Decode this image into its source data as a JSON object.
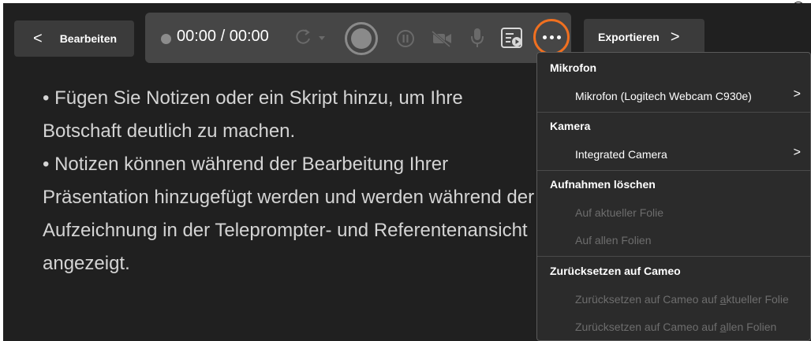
{
  "help_icon_glyph": "?",
  "back_button": {
    "icon": "chevron-left-icon",
    "chevron": "<",
    "label": "Bearbeiten"
  },
  "toolbar": {
    "timer": "00:00 / 00:00",
    "icons": [
      "record-indicator-icon",
      "retake-icon",
      "record-icon",
      "pause-icon",
      "camera-off-icon",
      "microphone-icon",
      "presenter-view-icon",
      "more-options-icon"
    ]
  },
  "export_button": {
    "label": "Exportieren",
    "chevron": ">"
  },
  "notes": {
    "lines": [
      "• Fügen Sie Notizen oder ein Skript hinzu, um Ihre",
      "Botschaft deutlich zu machen.",
      "• Notizen können während der Bearbeitung Ihrer",
      "Präsentation hinzugefügt werden und werden während der",
      "Aufzeichnung in der Teleprompter- und Referentenansicht",
      "angezeigt."
    ]
  },
  "menu": {
    "microphone_header": "Mikrofon",
    "microphone_value": "Mikrofon (Logitech Webcam C930e)",
    "camera_header": "Kamera",
    "camera_value": "Integrated Camera",
    "delete_header": "Aufnahmen löschen",
    "delete_current": "Auf aktueller Folie",
    "delete_all": "Auf allen Folien",
    "reset_header": "Zurücksetzen auf Cameo",
    "reset_current_pre": "Zurücksetzen auf Cameo auf ",
    "reset_current_accel": "a",
    "reset_current_post": "ktueller Folie",
    "reset_all_pre": "Zurücksetzen auf Cameo auf ",
    "reset_all_accel": "a",
    "reset_all_post": "llen Folien",
    "submenu_chevron": ">"
  },
  "colors": {
    "accent_ring": "#f07020",
    "background": "#202020",
    "toolbar": "#464646",
    "menu": "#2b2b2b"
  }
}
